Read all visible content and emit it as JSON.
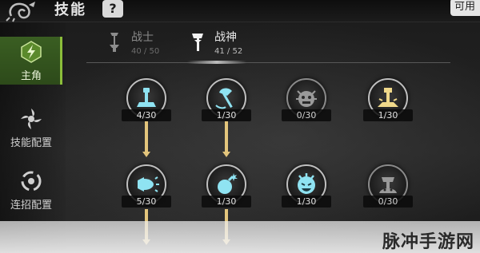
{
  "header": {
    "title": "技能",
    "help_label": "?",
    "points_label": "可用"
  },
  "sidebar": {
    "items": [
      {
        "label": "主角",
        "icon": "lightning-icon",
        "active": true
      },
      {
        "label": "技能配置",
        "icon": "shuriken-icon",
        "active": false
      },
      {
        "label": "连招配置",
        "icon": "swirl-icon",
        "active": false
      }
    ]
  },
  "class_tabs": [
    {
      "name": "战士",
      "points": "40 / 50",
      "icon": "sword-icon",
      "active": false
    },
    {
      "name": "战神",
      "points": "41 / 52",
      "icon": "axe-icon",
      "active": true
    }
  ],
  "skills": {
    "row1": [
      {
        "level": "4/30",
        "icon": "hammer-strike-icon",
        "locked": false
      },
      {
        "level": "1/30",
        "icon": "axe-swing-icon",
        "locked": false
      },
      {
        "level": "0/30",
        "icon": "demon-face-icon",
        "locked": true
      },
      {
        "level": "1/30",
        "icon": "ground-smash-icon",
        "locked": false
      }
    ],
    "row2": [
      {
        "level": "5/30",
        "icon": "roar-icon",
        "locked": false
      },
      {
        "level": "1/30",
        "icon": "bomb-icon",
        "locked": false
      },
      {
        "level": "1/30",
        "icon": "mask-icon",
        "locked": false
      },
      {
        "level": "0/30",
        "icon": "rage-icon",
        "locked": true
      }
    ]
  },
  "watermark": {
    "text": "脉冲手游网"
  },
  "colors": {
    "active_green": "#3a5e22",
    "accent_green": "#8bbd3a",
    "arrow_gold": "#e3c57c"
  }
}
